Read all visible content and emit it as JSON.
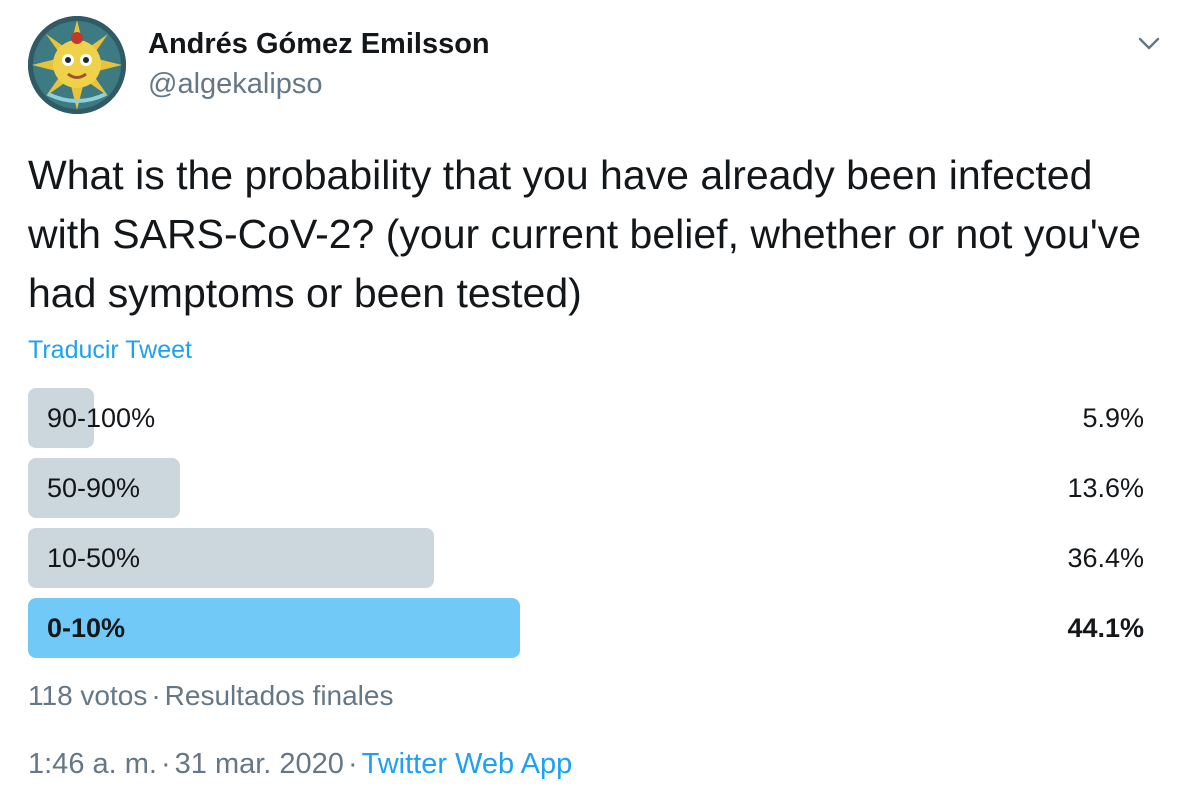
{
  "author": {
    "display_name": "Andrés Gómez Emilsson",
    "handle": "@algekalipso"
  },
  "tweet": {
    "text": "What is the probability that you have already been infected with SARS-CoV-2? (your current belief, whether or not you've had symptoms or been tested)",
    "translate_label": "Traducir Tweet"
  },
  "poll": {
    "options": [
      {
        "label": "90-100%",
        "percent": "5.9%",
        "value": 5.9
      },
      {
        "label": "50-90%",
        "percent": "13.6%",
        "value": 13.6
      },
      {
        "label": "10-50%",
        "percent": "36.4%",
        "value": 36.4
      },
      {
        "label": "0-10%",
        "percent": "44.1%",
        "value": 44.1,
        "winner": true
      }
    ],
    "votes": "118 votos",
    "status": "Resultados finales"
  },
  "meta": {
    "time": "1:46 a. m.",
    "date": "31 mar. 2020",
    "source": "Twitter Web App"
  },
  "colors": {
    "accent": "#1da1f2",
    "bar": "#ccd6dd",
    "winner_bar": "#71c9f8",
    "secondary_text": "#657786"
  },
  "icons": {
    "menu": "chevron-down-icon"
  }
}
